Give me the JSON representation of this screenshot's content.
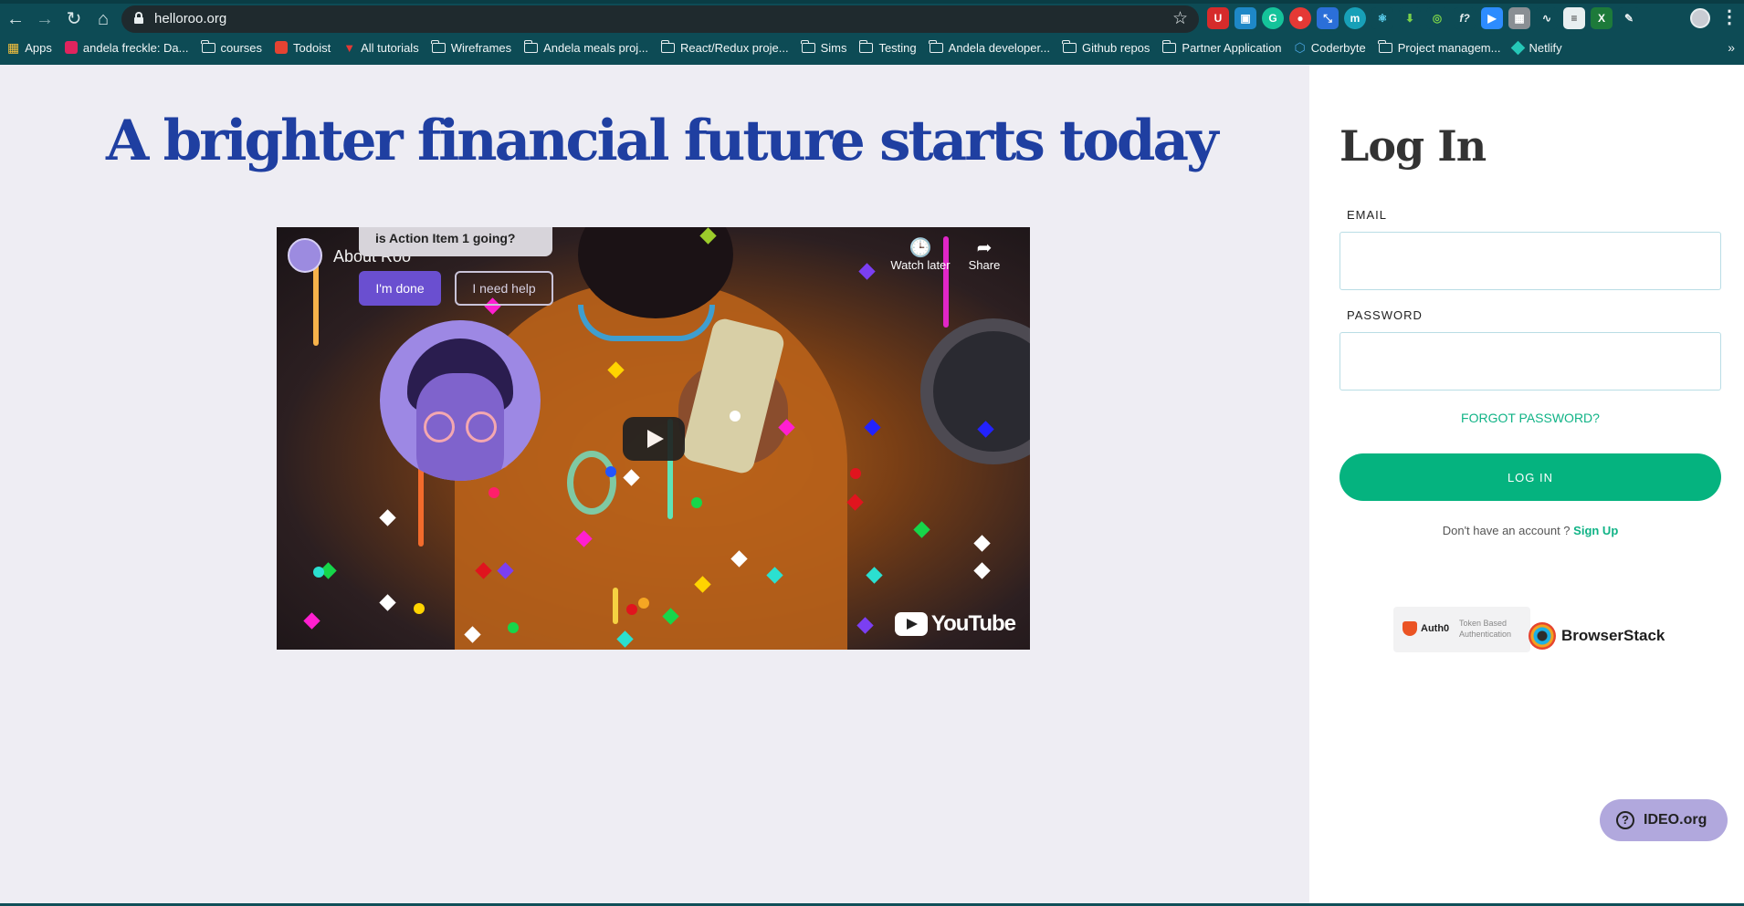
{
  "browser": {
    "url": "helloroo.org",
    "bookmarks": [
      {
        "label": "Apps",
        "icon": "apps-grid-icon"
      },
      {
        "label": "andela freckle: Da...",
        "icon": "freckle-icon"
      },
      {
        "label": "courses",
        "icon": "folder-icon"
      },
      {
        "label": "Todoist",
        "icon": "todoist-icon"
      },
      {
        "label": "All tutorials",
        "icon": "tutorials-icon"
      },
      {
        "label": "Wireframes",
        "icon": "folder-icon"
      },
      {
        "label": "Andela meals proj...",
        "icon": "folder-icon"
      },
      {
        "label": "React/Redux proje...",
        "icon": "folder-icon"
      },
      {
        "label": "Sims",
        "icon": "folder-icon"
      },
      {
        "label": "Testing",
        "icon": "folder-icon"
      },
      {
        "label": "Andela developer...",
        "icon": "folder-icon"
      },
      {
        "label": "Github repos",
        "icon": "folder-icon"
      },
      {
        "label": "Partner Application",
        "icon": "folder-icon"
      },
      {
        "label": "Coderbyte",
        "icon": "coderbyte-icon"
      },
      {
        "label": "Project managem...",
        "icon": "folder-icon"
      },
      {
        "label": "Netlify",
        "icon": "netlify-icon"
      }
    ],
    "more_label": "»"
  },
  "hero": {
    "headline": "A brighter financial future starts today"
  },
  "video": {
    "title": "About Roo",
    "bubble_text": "is Action Item 1 going?",
    "done_label": "I'm done",
    "help_label": "I need help",
    "watch_later_label": "Watch later",
    "share_label": "Share",
    "youtube_label": "YouTube"
  },
  "login": {
    "title": "Log In",
    "email_label": "EMAIL",
    "email_value": "",
    "password_label": "PASSWORD",
    "password_value": "",
    "forgot_label": "FORGOT PASSWORD?",
    "button_label": "LOG IN",
    "signup_prompt": "Don't have an account ?",
    "signup_link": "Sign Up"
  },
  "partners": {
    "auth0_name": "Auth0",
    "auth0_desc": "Token Based Authentication",
    "browserstack_name": "BrowserStack"
  },
  "help_widget": {
    "label": "IDEO.org"
  },
  "colors": {
    "headline": "#1f3fa1",
    "accent_green": "#05b37f",
    "chrome_bg": "#0d4b55",
    "page_bg": "#eeedf3"
  }
}
